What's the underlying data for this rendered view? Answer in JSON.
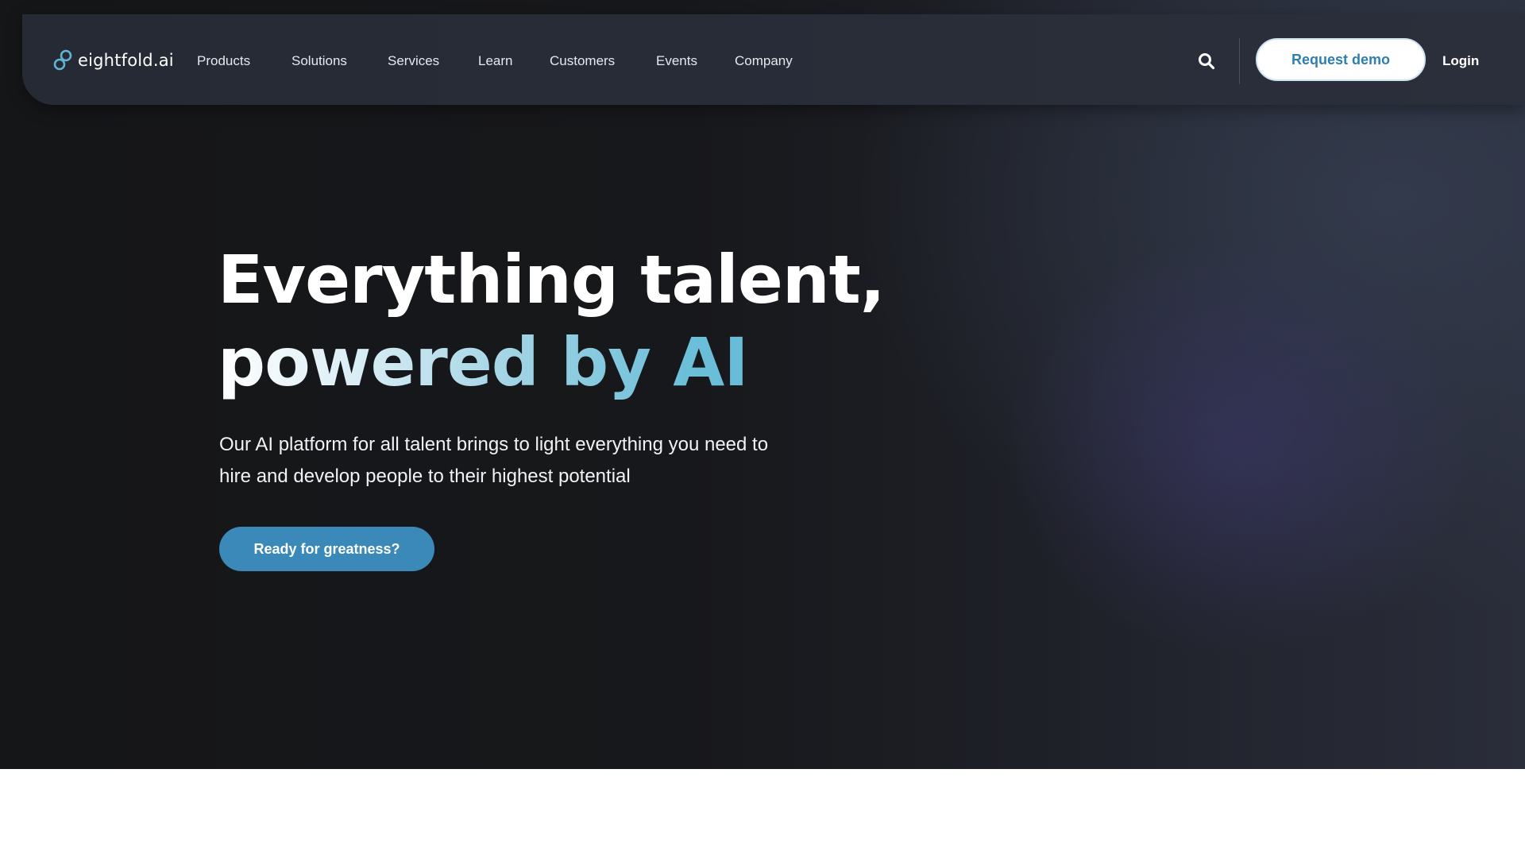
{
  "brand": {
    "name": "eightfold.ai",
    "accent": "#3a89b8",
    "logo_icon": "infinity-link-logo"
  },
  "nav": {
    "items": [
      {
        "label": "Products"
      },
      {
        "label": "Solutions"
      },
      {
        "label": "Services"
      },
      {
        "label": "Learn"
      },
      {
        "label": "Customers"
      },
      {
        "label": "Events"
      },
      {
        "label": "Company"
      }
    ],
    "search_icon": "search-icon",
    "request_demo_label": "Request demo",
    "login_label": "Login"
  },
  "hero": {
    "headline_line1": "Everything talent,",
    "headline_line2": "powered by AI",
    "subtext": "Our AI platform for all talent brings to light everything you need to hire and develop people to their highest potential",
    "cta_label": "Ready for greatness?"
  },
  "colors": {
    "hero_background": "#151618",
    "nav_background": "#2a2e39",
    "headline_gradient_end": "#5fb5d3",
    "demo_text": "#2e7fae"
  }
}
